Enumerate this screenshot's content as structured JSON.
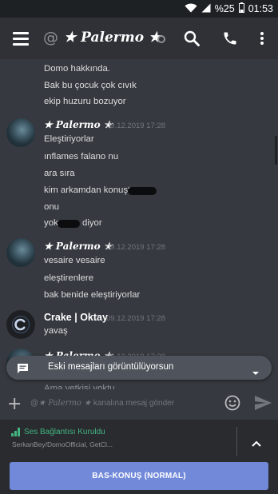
{
  "status_bar": {
    "battery_percent": "%25",
    "time": "01:53"
  },
  "header": {
    "hash_symbol": "@",
    "channel_name": "★ Palermo ★",
    "icons": [
      "menu-icon",
      "search-icon",
      "phone-icon",
      "more-vert-icon"
    ]
  },
  "messages": {
    "continuation_lines": [
      "Domo hakkında.",
      "Bak bu çocuk çok cıvık",
      "ekip huzuru bozuyor"
    ],
    "groups": [
      {
        "author": "★ Palermo ★",
        "timestamp": "09.12.2019 17:28",
        "lines": [
          "Eleştiriyorlar",
          "ınflames falano nu",
          "ara sıra",
          "kim arkamdan konuştu",
          "onu",
          "yok",
          "diyor"
        ]
      },
      {
        "author": "★ Palermo ★",
        "timestamp": "09.12.2019 17:28",
        "lines": [
          "vesaire vesaire",
          "eleştirenlere",
          "bak benide eleştiriyorlar"
        ]
      },
      {
        "author": "Crake | Oktay",
        "timestamp": "09.12.2019 17:28",
        "lines": [
          "yavaş"
        ]
      },
      {
        "author": "★ Palermo ★",
        "timestamp": "09.12.2019 17:28",
        "lines": [
          "Ama yetkisi yoktu"
        ]
      }
    ]
  },
  "jump_bar": {
    "label": "Eski mesajları görüntülüyorsun"
  },
  "composer": {
    "placeholder_prefix": "@",
    "placeholder_channel": "★ Palermo ★",
    "placeholder_suffix": "kanalına mesaj gönder"
  },
  "voice": {
    "status": "Ses Bağlantısı Kuruldu",
    "subtitle": "SerkanBey/DomoOfficial, GetCl..."
  },
  "push_to_talk": {
    "label": "BAS-KONUŞ (NORMAL)"
  },
  "colors": {
    "accent": "#7289da",
    "voice_green": "#43b581",
    "background": "#36393f",
    "header": "#2f3136"
  }
}
